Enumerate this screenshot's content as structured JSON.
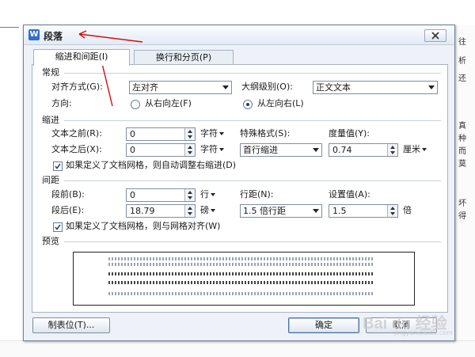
{
  "background": {
    "side_chars": [
      "往",
      "析",
      "还",
      "真",
      "种",
      "而",
      "莫",
      "坏",
      "得"
    ]
  },
  "dialog": {
    "title": "段落",
    "tabs": [
      "缩进和间距(I)",
      "换行和分页(P)"
    ],
    "general": {
      "section": "常规",
      "align_label": "对齐方式(G):",
      "align_value": "左对齐",
      "outline_label": "大纲级别(O):",
      "outline_value": "正文文本",
      "direction_label": "方向:",
      "rtl_label": "从右向左(F)",
      "ltr_label": "从左向右(L)",
      "ltr_selected": true
    },
    "indent": {
      "section": "缩进",
      "before_label": "文本之前(R):",
      "before_value": "0",
      "before_unit": "字符",
      "after_label": "文本之后(X):",
      "after_value": "0",
      "after_unit": "字符",
      "special_label": "特殊格式(S):",
      "special_value": "首行缩进",
      "measure_label": "度量值(Y):",
      "measure_value": "0.74",
      "measure_unit": "厘米",
      "grid_check_label": "如果定义了文档网格，则自动调整右缩进(D)",
      "grid_checked": true
    },
    "spacing": {
      "section": "间距",
      "before_label": "段前(B):",
      "before_value": "0",
      "before_unit": "行",
      "after_label": "段后(E):",
      "after_value": "18.79",
      "after_unit": "磅",
      "line_label": "行距(N):",
      "line_value": "1.5 倍行距",
      "setting_label": "设置值(A):",
      "setting_value": "1.5",
      "setting_unit": "倍",
      "grid_check_label": "如果定义了文档网格，则与网格对齐(W)",
      "grid_checked": true
    },
    "preview": {
      "section": "预览"
    },
    "buttons": {
      "tabs_label": "制表位(T)...",
      "ok_label": "确定",
      "cancel_label": "取消"
    }
  },
  "watermark": {
    "text": "Bai du 经验",
    "sub": "jingyan.baidu.com"
  },
  "colors": {
    "annotation_arrow": "#cc1111",
    "dialog_bg": "#eef2f8",
    "accent": "#2f6fcf"
  },
  "icons": {
    "app": "wps-writer-icon",
    "close": "close-icon"
  }
}
